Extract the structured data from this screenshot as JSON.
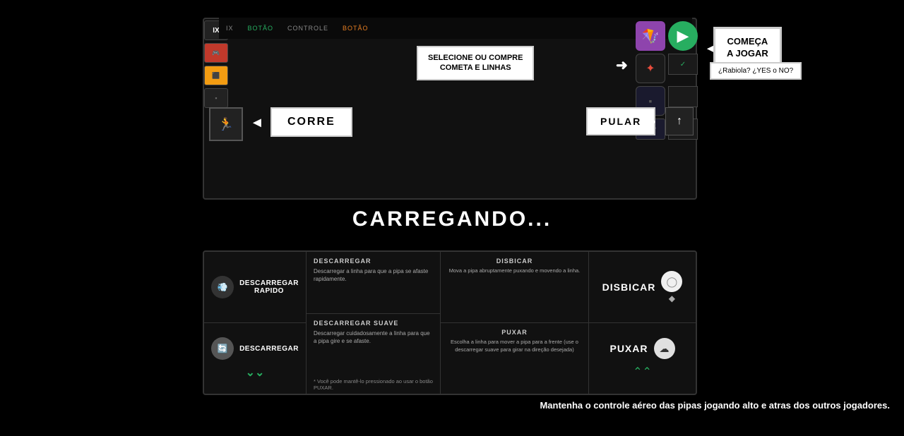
{
  "topbar": {
    "items": [
      {
        "label": "IX",
        "state": "default"
      },
      {
        "label": "BOTÃO",
        "state": "active"
      },
      {
        "label": "CONTROLE",
        "state": "default"
      },
      {
        "label": "BOTÃO",
        "state": "orange"
      }
    ]
  },
  "selecione": {
    "line1": "SELECIONE OU COMPRE",
    "line2": "COMETA E LINHAS"
  },
  "comeca": {
    "line1": "COMEÇA",
    "line2": "A JOGAR"
  },
  "rabiola": "¿Rabiola? ¿YES o NO?",
  "corre": {
    "label": "CORRE"
  },
  "pular": {
    "label": "PULAR"
  },
  "carregando": "CARREGANDO...",
  "bottom": {
    "descarregar_rapido": {
      "label": "DESCARREGAR\nRAPIDO"
    },
    "descarregar": {
      "label": "DESCARREGAR"
    },
    "box1": {
      "title": "DESCARREGAR",
      "text": "Descarregar a linha para que a pipa se\nafaste rapidamente."
    },
    "box2": {
      "title": "DESCARREGAR SUAVE",
      "text": "Descarregar cuidadosamente a linha\npara que a pipa gire e se afaste."
    },
    "box3": {
      "title": "DISBICAR",
      "text": "Mova a pipa abruptamente puxando e\nmovendo a linha."
    },
    "box4": {
      "title": "PUXAR",
      "text": "Escolha a linha para mover a pipa para a frente (use o descarregar suave para girar na direção desejada)"
    },
    "note": "* Você pode mantê-lo pressionado ao usar o botão PUXAR.",
    "disbicar": "DISBICAR",
    "puxar": "PUXAR"
  },
  "footer": {
    "text": "Mantenha o controle aéreo das pipas jogando alto e atras\ndos outros jogadores."
  }
}
